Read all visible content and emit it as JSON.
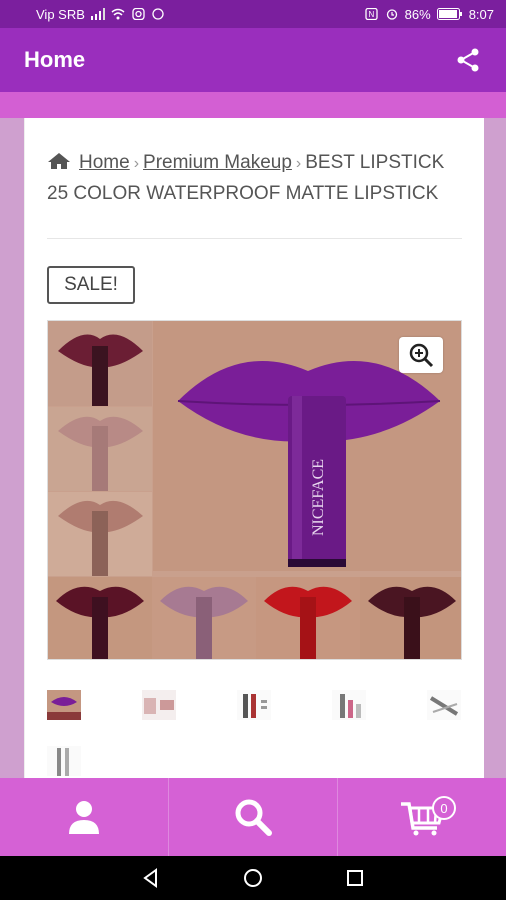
{
  "status_bar": {
    "carrier": "Vip SRB",
    "battery": "86%",
    "time": "8:07"
  },
  "app_bar": {
    "title": "Home",
    "share_icon": "share-icon"
  },
  "breadcrumb": {
    "home_icon": "home-icon",
    "items": [
      "Home",
      "Premium Makeup"
    ],
    "current": "BEST LIPSTICK 25 COLOR WATERPROOF MATTE LIPSTICK",
    "separator": "›"
  },
  "product": {
    "badge": "SALE!",
    "image_brand_text": "NICEFACE",
    "zoom_icon": "zoom-in-icon",
    "thumbnails_count": 6
  },
  "bottom_nav": {
    "items": [
      {
        "icon": "user-icon"
      },
      {
        "icon": "search-icon"
      },
      {
        "icon": "cart-icon",
        "badge": "0"
      }
    ]
  },
  "colors": {
    "status_bar": "#7b1f9e",
    "app_bar": "#9a2ebd",
    "accent": "#d561d5",
    "side": "#cfa0cf"
  }
}
